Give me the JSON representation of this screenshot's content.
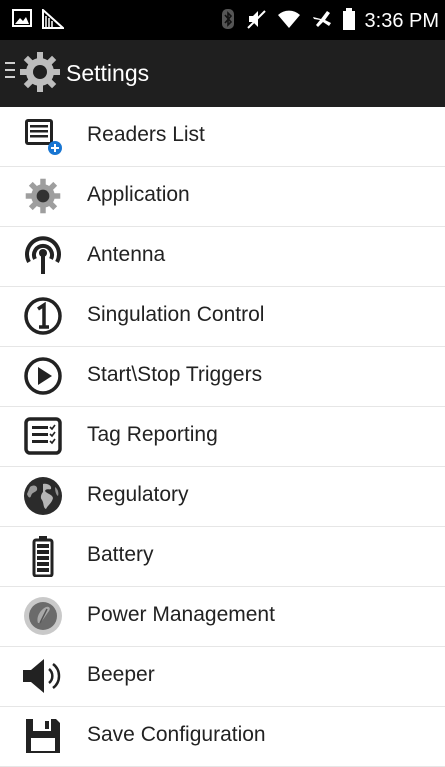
{
  "status_bar": {
    "time": "3:36 PM",
    "icons": [
      "gallery-icon",
      "signal-icon",
      "bluetooth-icon",
      "mute-icon",
      "wifi-icon",
      "airplane-icon",
      "battery-icon"
    ]
  },
  "app_bar": {
    "title": "Settings",
    "menu_icon": "drawer-menu-icon",
    "logo_icon": "gear-icon"
  },
  "settings": {
    "items": [
      {
        "label": "Readers List",
        "icon": "readers-list-icon"
      },
      {
        "label": "Application",
        "icon": "gear-icon"
      },
      {
        "label": "Antenna",
        "icon": "antenna-icon"
      },
      {
        "label": "Singulation Control",
        "icon": "singulation-icon"
      },
      {
        "label": "Start\\Stop Triggers",
        "icon": "play-icon"
      },
      {
        "label": "Tag Reporting",
        "icon": "tag-report-icon"
      },
      {
        "label": "Regulatory",
        "icon": "globe-icon"
      },
      {
        "label": "Battery",
        "icon": "battery-icon"
      },
      {
        "label": "Power Management",
        "icon": "power-icon"
      },
      {
        "label": "Beeper",
        "icon": "speaker-icon"
      },
      {
        "label": "Save Configuration",
        "icon": "save-icon"
      }
    ]
  }
}
